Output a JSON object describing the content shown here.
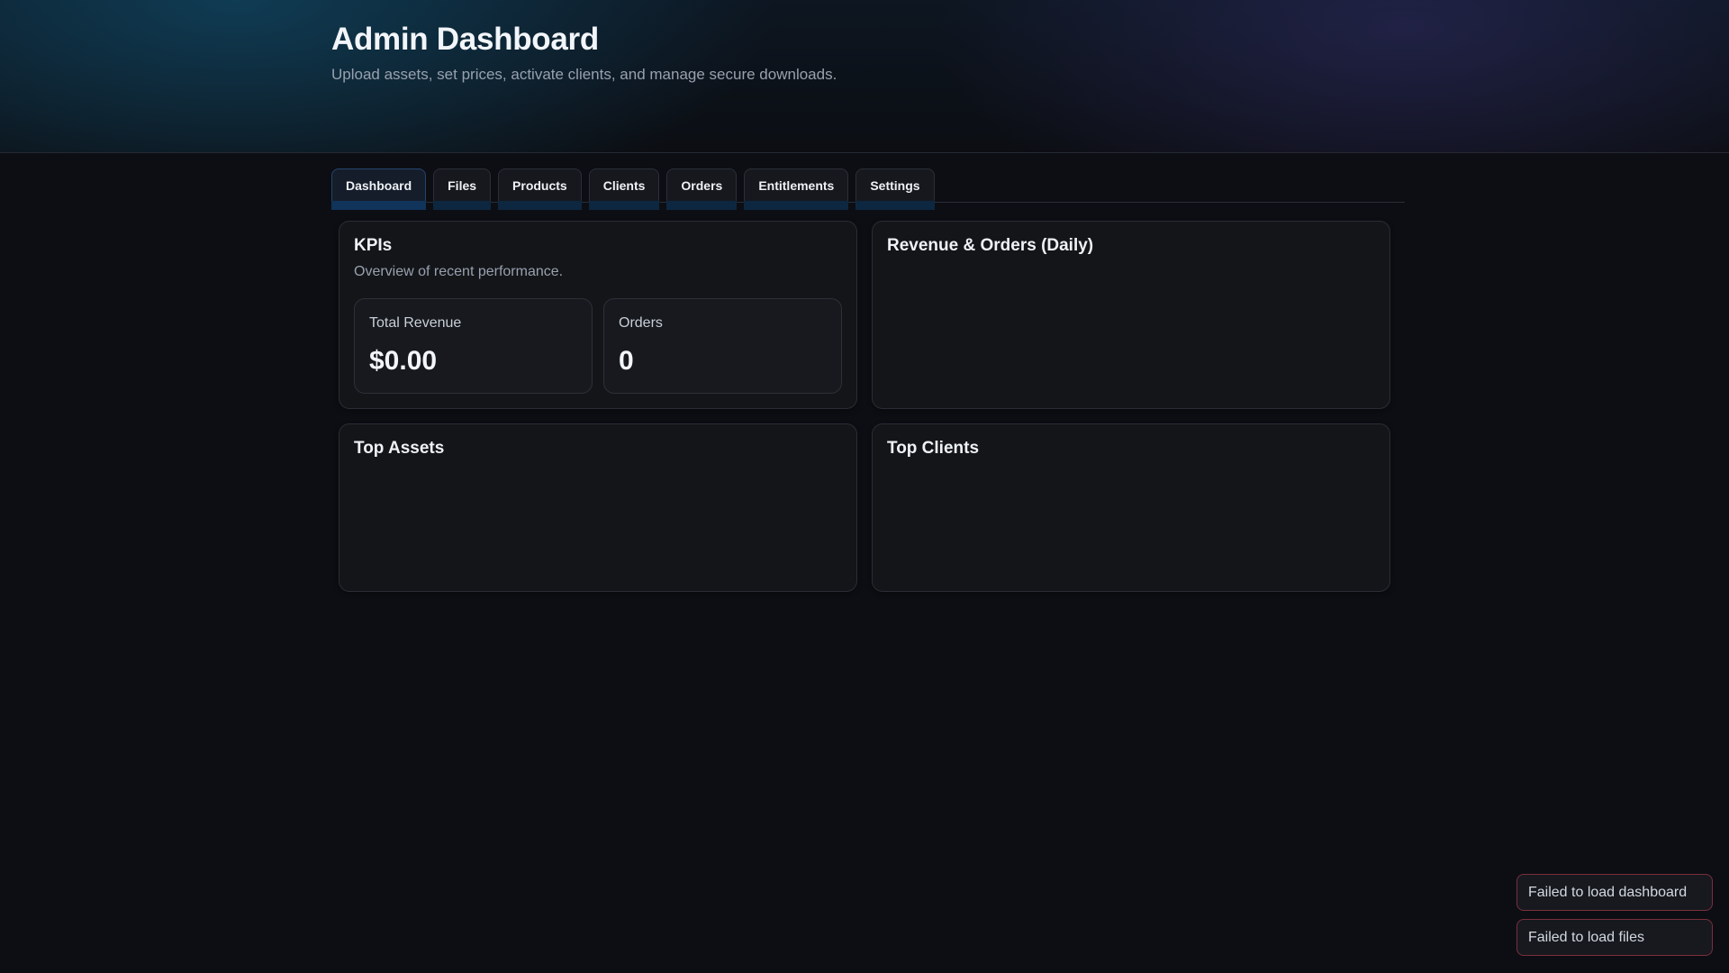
{
  "header": {
    "title": "Admin Dashboard",
    "subtitle": "Upload assets, set prices, activate clients, and manage secure downloads."
  },
  "tabs": [
    {
      "label": "Dashboard",
      "active": true
    },
    {
      "label": "Files",
      "active": false
    },
    {
      "label": "Products",
      "active": false
    },
    {
      "label": "Clients",
      "active": false
    },
    {
      "label": "Orders",
      "active": false
    },
    {
      "label": "Entitlements",
      "active": false
    },
    {
      "label": "Settings",
      "active": false
    }
  ],
  "kpis": {
    "title": "KPIs",
    "subtitle": "Overview of recent performance.",
    "total_revenue": {
      "label": "Total Revenue",
      "value": "$0.00"
    },
    "orders": {
      "label": "Orders",
      "value": "0"
    }
  },
  "revenue_chart": {
    "title": "Revenue & Orders (Daily)"
  },
  "top_assets": {
    "title": "Top Assets"
  },
  "top_clients": {
    "title": "Top Clients"
  },
  "toasts": [
    {
      "message": "Failed to load dashboard"
    },
    {
      "message": "Failed to load files"
    }
  ],
  "colors": {
    "background": "#0c0e13",
    "card": "#131519",
    "active_tab_accent": "#10345a",
    "toast_error_border": "#7a2f3a"
  }
}
